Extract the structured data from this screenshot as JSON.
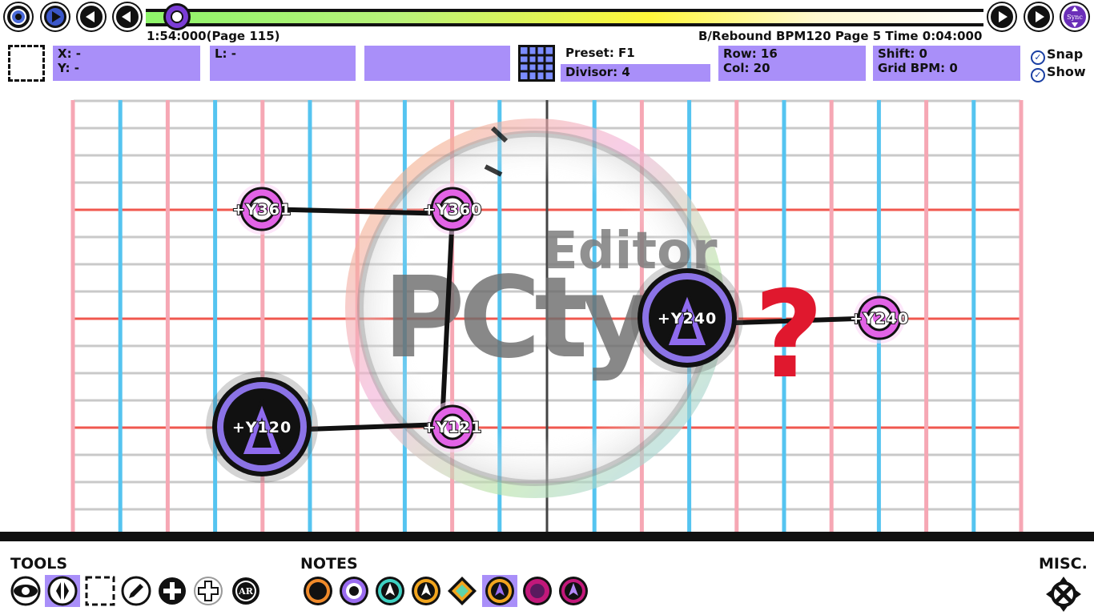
{
  "top": {
    "timeline_time": "1:54:000(Page 115)",
    "status": "B/Rebound  BPM120 Page 5 Time 0:04:000",
    "sync_label": "Sync"
  },
  "info": {
    "x_label": "X: -",
    "y_label": "Y: -",
    "l_label": "L: -",
    "preset": "Preset: F1",
    "divisor": "Divisor: 4",
    "row": "Row: 16",
    "col": "Col: 20",
    "shift": "Shift: 0",
    "grid_bpm": "Grid BPM: 0",
    "snap": "Snap",
    "show": "Show"
  },
  "notes": [
    {
      "label": "+Y361",
      "kind": "small"
    },
    {
      "label": "+Y360",
      "kind": "small"
    },
    {
      "label": "+Y240",
      "kind": "large"
    },
    {
      "label": "+Y240",
      "kind": "small"
    },
    {
      "label": "+Y120",
      "kind": "large"
    },
    {
      "label": "+Y121",
      "kind": "small"
    }
  ],
  "watermark": {
    "line1": "Editor",
    "brand": "PCty"
  },
  "question_mark": "?",
  "bottom": {
    "tools_title": "TOOLS",
    "notes_title": "NOTES",
    "misc_title": "MISC.",
    "ar_label": "AR"
  },
  "colors": {
    "panel_purple": "#a98ff9",
    "grid_pink": "#f6a7b4",
    "grid_blue": "#55c4f0",
    "grid_red": "#f0584f",
    "question_red": "#e0182e"
  }
}
